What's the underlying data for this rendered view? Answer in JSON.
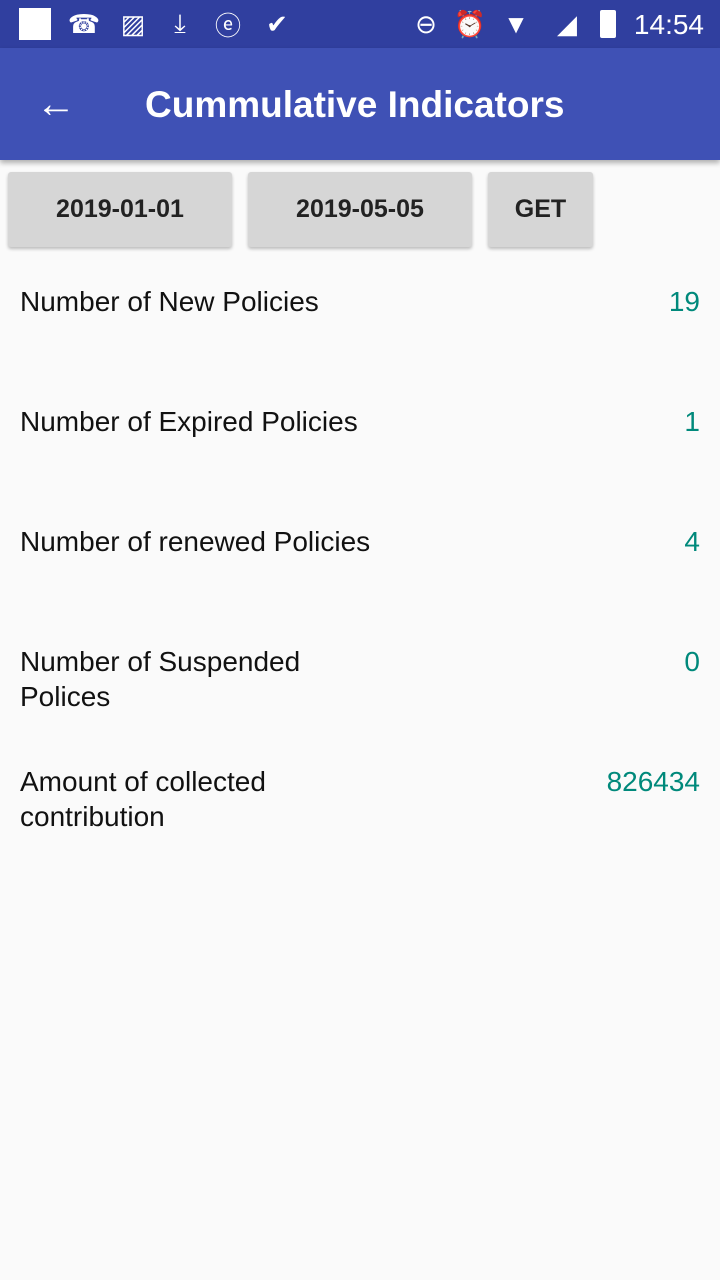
{
  "status_bar": {
    "time": "14:54"
  },
  "app_bar": {
    "title": "Cummulative Indicators"
  },
  "filters": {
    "from_date": "2019-01-01",
    "to_date": "2019-05-05",
    "get_label": "GET"
  },
  "indicators": [
    {
      "label": "Number of New Policies",
      "value": "19"
    },
    {
      "label": "Number of Expired Policies",
      "value": "1"
    },
    {
      "label": "Number of renewed Policies",
      "value": "4"
    },
    {
      "label": "Number of Suspended Polices",
      "value": "0"
    },
    {
      "label": "Amount of collected contribution",
      "value": "826434"
    }
  ],
  "colors": {
    "primary": "#3f51b5",
    "primary_dark": "#303f9f",
    "value": "#00897b"
  }
}
